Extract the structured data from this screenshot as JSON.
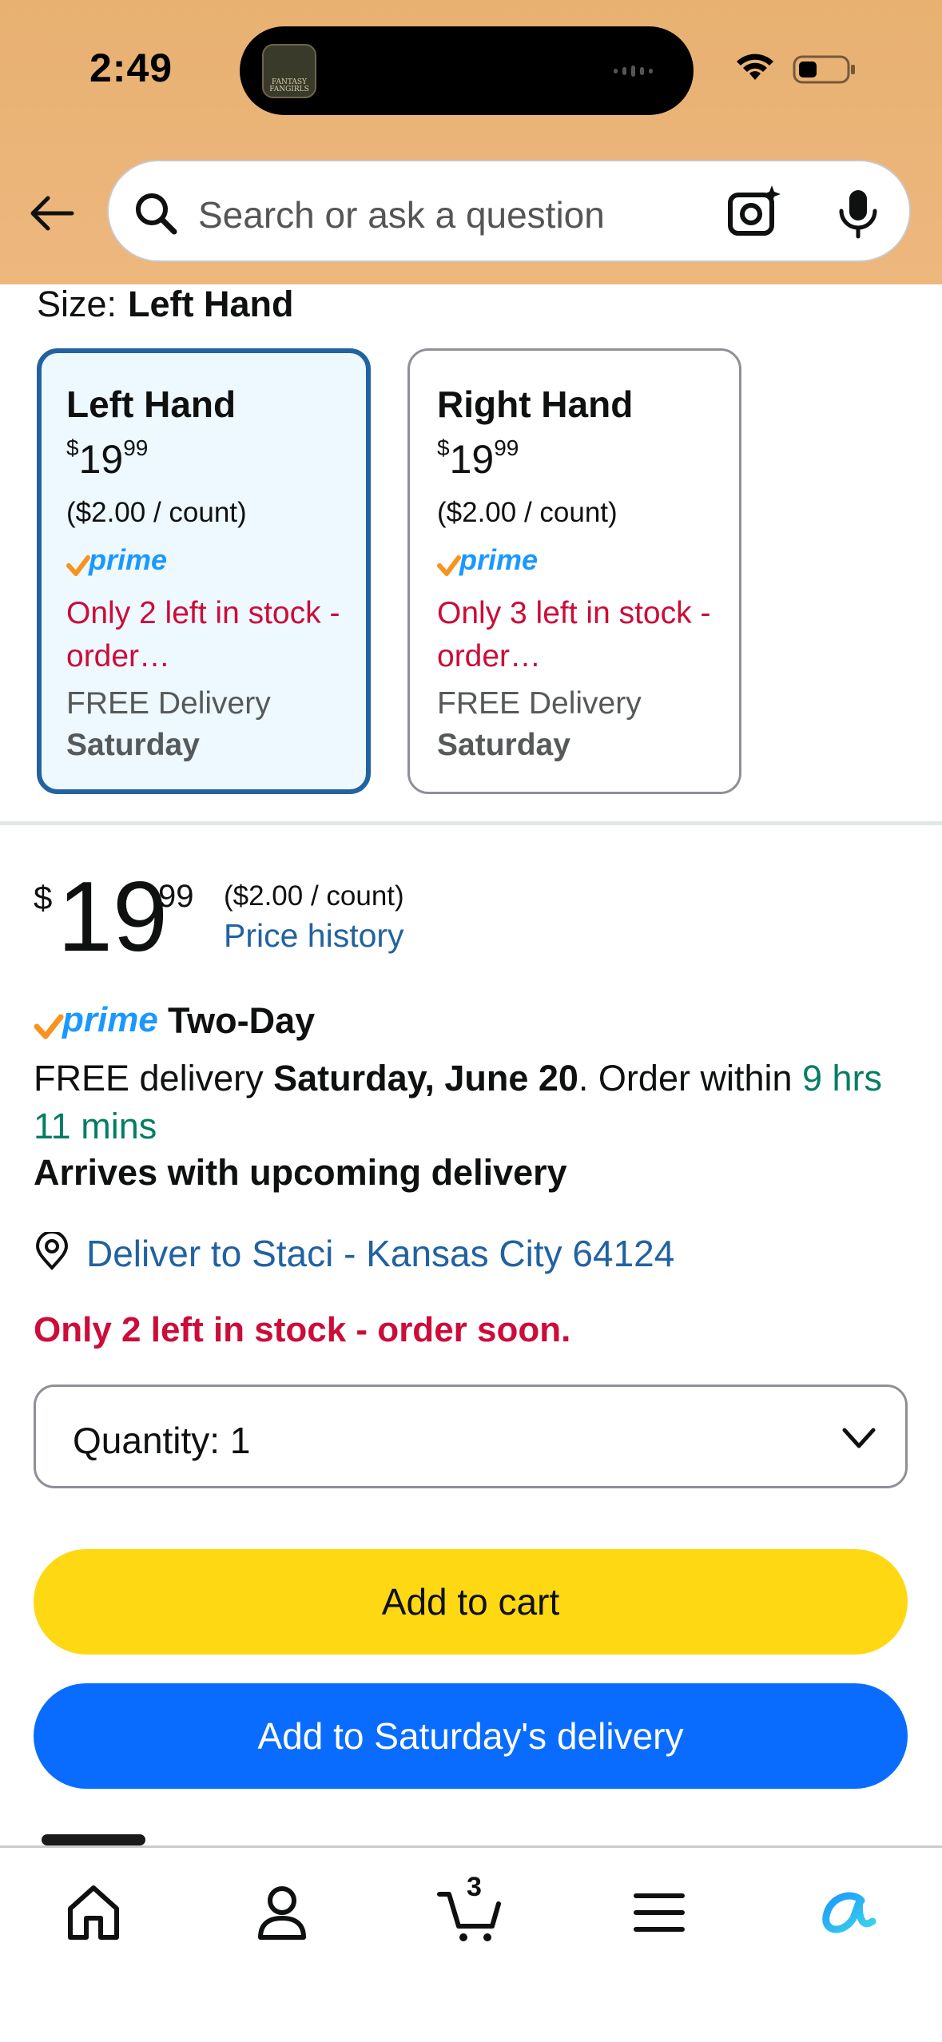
{
  "status_bar": {
    "time": "2:49",
    "island_app_text": "FANTASY FANGIRLS"
  },
  "search": {
    "placeholder": "Search or ask a question"
  },
  "size": {
    "label": "Size:",
    "selected": "Left Hand"
  },
  "variants": [
    {
      "name": "Left Hand",
      "currency": "$",
      "price_whole": "19",
      "price_frac": "99",
      "unit_price": "($2.00 / count)",
      "prime": "prime",
      "stock": "Only 2 left in stock - order…",
      "delivery": "FREE Delivery",
      "delivery_day": "Saturday",
      "selected": true
    },
    {
      "name": "Right Hand",
      "currency": "$",
      "price_whole": "19",
      "price_frac": "99",
      "unit_price": "($2.00 / count)",
      "prime": "prime",
      "stock": "Only 3 left in stock - order…",
      "delivery": "FREE Delivery",
      "delivery_day": "Saturday",
      "selected": false
    }
  ],
  "price": {
    "currency": "$",
    "whole": "19",
    "frac": "99",
    "unit_price": "($2.00 / count)",
    "history_link": "Price history"
  },
  "shipping": {
    "prime_word": "prime",
    "prime_label": "Two-Day",
    "free_prefix": "FREE delivery ",
    "date": "Saturday, June 20",
    "order_within": ". Order within ",
    "countdown": "9 hrs 11 mins",
    "upcoming": "Arrives with upcoming delivery",
    "deliver_to": "Deliver to Staci - Kansas City 64124"
  },
  "stock_alert": "Only 2 left in stock - order soon.",
  "quantity": {
    "label": "Quantity:",
    "value": "1"
  },
  "buttons": {
    "add_to_cart": "Add to cart",
    "add_to_delivery": "Add to Saturday's delivery"
  },
  "nav": {
    "cart_count": "3"
  },
  "colors": {
    "header": "#e8b172",
    "selected_border": "#2162a1",
    "link": "#2162a1",
    "alert": "#cc0c39",
    "countdown": "#067d62",
    "cart_button": "#ffd814",
    "delivery_button": "#0a6cff",
    "prime": "#1a98ff"
  }
}
